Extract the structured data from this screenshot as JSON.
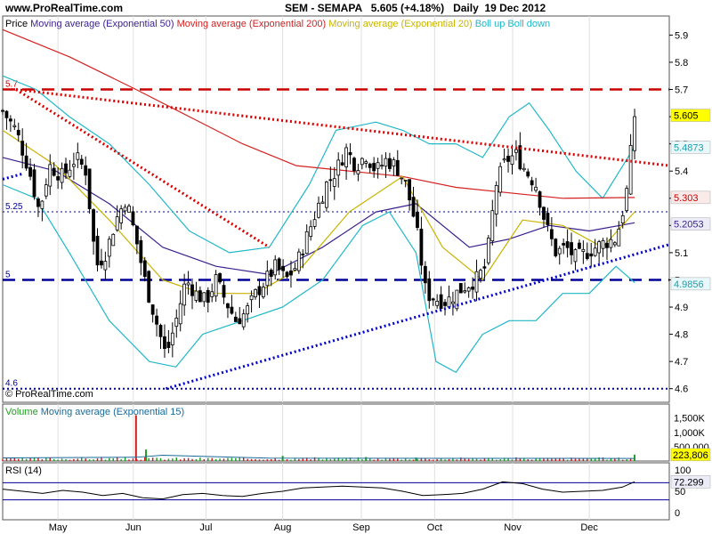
{
  "header": {
    "site": "www.ProRealTime.com",
    "title_symbol": "SEM - SEMAPA",
    "title_price": "5.605 (+4.18%)",
    "title_period": "Daily  19 Dec 2012"
  },
  "copyright": "© ProRealTime.com",
  "legend_price": [
    {
      "text": "Price",
      "color": "#000000"
    },
    {
      "text": "Moving average (Exponential 50)",
      "color": "#3a1f8c"
    },
    {
      "text": "Moving average (Exponential 200)",
      "color": "#d42020"
    },
    {
      "text": "Moving average (Exponential 20)",
      "color": "#c8b400"
    },
    {
      "text": "Boll up Boll down",
      "color": "#20b8c8"
    }
  ],
  "legend_volume": [
    {
      "text": "Volume",
      "color": "#20a020"
    },
    {
      "text": "Moving average (Exponential 15)",
      "color": "#1a6a9a"
    }
  ],
  "legend_rsi": [
    {
      "text": "RSI (14)",
      "color": "#000000"
    }
  ],
  "chart_data": {
    "type": "candlestick",
    "x_labels": [
      "May",
      "Jun",
      "Jul",
      "Aug",
      "Sep",
      "Oct",
      "Nov",
      "Dec"
    ],
    "price_axis": {
      "ylim": [
        4.55,
        5.97
      ],
      "ticks": [
        "5.9",
        "5.8",
        "5.7",
        "5.6",
        "5.5",
        "5.4",
        "5.3",
        "5.2",
        "5.1",
        "5",
        "4.9",
        "4.8",
        "4.7",
        "4.6"
      ]
    },
    "level_labels": [
      {
        "text": "5.7",
        "value": 5.7,
        "color": "#cc0000"
      },
      {
        "text": "5.25",
        "value": 5.25,
        "color": "#000099"
      },
      {
        "text": "5",
        "value": 5.0,
        "color": "#000099"
      },
      {
        "text": "4.6",
        "value": 4.6,
        "color": "#000099"
      }
    ],
    "price_badges": [
      {
        "text": "5.605",
        "value": 5.605,
        "bg": "#ffff00",
        "fg": "#000000"
      },
      {
        "text": "5.4873",
        "value": 5.4873,
        "bg": "#e8f8fb",
        "fg": "#1aa0b0"
      },
      {
        "text": "5.303",
        "value": 5.303,
        "bg": "#fbeaea",
        "fg": "#cc0000"
      },
      {
        "text": "5.2053",
        "value": 5.2053,
        "bg": "#ececf8",
        "fg": "#3a1f8c"
      },
      {
        "text": "4.9856",
        "value": 4.9856,
        "bg": "#e8f8fb",
        "fg": "#1aa0b0"
      }
    ],
    "horizontal_lines": [
      {
        "value": 5.7,
        "color": "#cc0000",
        "style": "dashed"
      },
      {
        "value": 5.0,
        "color": "#000099",
        "style": "dashed"
      },
      {
        "value": 4.6,
        "color": "#000099",
        "style": "dotted"
      },
      {
        "value": 5.25,
        "color": "#000099",
        "style": "thin-dotted"
      }
    ],
    "trendlines": [
      {
        "color": "#dd0000",
        "from": [
          0.02,
          5.7
        ],
        "to": [
          0.4,
          5.12
        ]
      },
      {
        "color": "#dd0000",
        "from": [
          0.02,
          5.7
        ],
        "to": [
          1.0,
          5.42
        ]
      },
      {
        "color": "#0000cc",
        "from": [
          0.245,
          4.6
        ],
        "to": [
          1.0,
          5.13
        ]
      },
      {
        "color": "#0000cc",
        "from": [
          0.0,
          5.37
        ],
        "to": [
          0.03,
          5.39
        ]
      }
    ],
    "close_path": [
      [
        0.0,
        5.62
      ],
      [
        0.02,
        5.55
      ],
      [
        0.04,
        5.4
      ],
      [
        0.055,
        5.25
      ],
      [
        0.07,
        5.42
      ],
      [
        0.09,
        5.38
      ],
      [
        0.11,
        5.45
      ],
      [
        0.125,
        5.4
      ],
      [
        0.14,
        5.05
      ],
      [
        0.155,
        5.1
      ],
      [
        0.17,
        5.22
      ],
      [
        0.185,
        5.3
      ],
      [
        0.2,
        5.15
      ],
      [
        0.215,
        4.98
      ],
      [
        0.23,
        4.85
      ],
      [
        0.245,
        4.72
      ],
      [
        0.26,
        4.85
      ],
      [
        0.275,
        5.0
      ],
      [
        0.29,
        4.95
      ],
      [
        0.305,
        4.92
      ],
      [
        0.32,
        5.0
      ],
      [
        0.335,
        4.92
      ],
      [
        0.35,
        4.85
      ],
      [
        0.365,
        4.88
      ],
      [
        0.38,
        4.95
      ],
      [
        0.395,
        5.0
      ],
      [
        0.41,
        5.05
      ],
      [
        0.425,
        5.0
      ],
      [
        0.44,
        5.05
      ],
      [
        0.455,
        5.15
      ],
      [
        0.47,
        5.25
      ],
      [
        0.485,
        5.35
      ],
      [
        0.5,
        5.4
      ],
      [
        0.515,
        5.48
      ],
      [
        0.53,
        5.42
      ],
      [
        0.545,
        5.46
      ],
      [
        0.56,
        5.4
      ],
      [
        0.575,
        5.44
      ],
      [
        0.59,
        5.42
      ],
      [
        0.605,
        5.35
      ],
      [
        0.62,
        5.2
      ],
      [
        0.635,
        4.95
      ],
      [
        0.65,
        4.93
      ],
      [
        0.665,
        4.92
      ],
      [
        0.68,
        4.95
      ],
      [
        0.695,
        4.98
      ],
      [
        0.71,
        5.0
      ],
      [
        0.725,
        5.05
      ],
      [
        0.74,
        5.35
      ],
      [
        0.755,
        5.44
      ],
      [
        0.77,
        5.46
      ],
      [
        0.785,
        5.4
      ],
      [
        0.8,
        5.35
      ],
      [
        0.815,
        5.2
      ],
      [
        0.83,
        5.1
      ],
      [
        0.845,
        5.12
      ],
      [
        0.86,
        5.08
      ],
      [
        0.875,
        5.1
      ],
      [
        0.89,
        5.12
      ],
      [
        0.905,
        5.14
      ],
      [
        0.92,
        5.15
      ],
      [
        0.935,
        5.3
      ],
      [
        0.948,
        5.605
      ]
    ],
    "ema20": [
      [
        0.0,
        5.55
      ],
      [
        0.08,
        5.42
      ],
      [
        0.16,
        5.22
      ],
      [
        0.24,
        5.0
      ],
      [
        0.3,
        4.95
      ],
      [
        0.38,
        4.95
      ],
      [
        0.45,
        5.05
      ],
      [
        0.52,
        5.25
      ],
      [
        0.6,
        5.38
      ],
      [
        0.66,
        5.12
      ],
      [
        0.72,
        5.0
      ],
      [
        0.78,
        5.22
      ],
      [
        0.84,
        5.2
      ],
      [
        0.9,
        5.12
      ],
      [
        0.948,
        5.25
      ]
    ],
    "ema50": [
      [
        0.0,
        5.45
      ],
      [
        0.08,
        5.4
      ],
      [
        0.16,
        5.28
      ],
      [
        0.24,
        5.12
      ],
      [
        0.32,
        5.05
      ],
      [
        0.4,
        5.02
      ],
      [
        0.48,
        5.12
      ],
      [
        0.56,
        5.25
      ],
      [
        0.62,
        5.28
      ],
      [
        0.7,
        5.12
      ],
      [
        0.76,
        5.15
      ],
      [
        0.82,
        5.2
      ],
      [
        0.88,
        5.18
      ],
      [
        0.948,
        5.21
      ]
    ],
    "ema200": [
      [
        0.0,
        5.92
      ],
      [
        0.1,
        5.82
      ],
      [
        0.2,
        5.7
      ],
      [
        0.28,
        5.6
      ],
      [
        0.36,
        5.5
      ],
      [
        0.44,
        5.42
      ],
      [
        0.52,
        5.4
      ],
      [
        0.6,
        5.38
      ],
      [
        0.68,
        5.34
      ],
      [
        0.76,
        5.32
      ],
      [
        0.84,
        5.3
      ],
      [
        0.948,
        5.303
      ]
    ],
    "boll_up": [
      [
        0.0,
        5.75
      ],
      [
        0.05,
        5.7
      ],
      [
        0.1,
        5.6
      ],
      [
        0.16,
        5.5
      ],
      [
        0.22,
        5.35
      ],
      [
        0.28,
        5.18
      ],
      [
        0.34,
        5.1
      ],
      [
        0.4,
        5.12
      ],
      [
        0.46,
        5.35
      ],
      [
        0.5,
        5.55
      ],
      [
        0.56,
        5.58
      ],
      [
        0.6,
        5.55
      ],
      [
        0.64,
        5.5
      ],
      [
        0.68,
        5.5
      ],
      [
        0.72,
        5.45
      ],
      [
        0.76,
        5.6
      ],
      [
        0.79,
        5.65
      ],
      [
        0.82,
        5.55
      ],
      [
        0.86,
        5.4
      ],
      [
        0.9,
        5.3
      ],
      [
        0.948,
        5.49
      ]
    ],
    "boll_down": [
      [
        0.0,
        5.35
      ],
      [
        0.05,
        5.3
      ],
      [
        0.1,
        5.1
      ],
      [
        0.16,
        4.85
      ],
      [
        0.22,
        4.7
      ],
      [
        0.26,
        4.68
      ],
      [
        0.3,
        4.8
      ],
      [
        0.36,
        4.85
      ],
      [
        0.42,
        4.9
      ],
      [
        0.48,
        5.0
      ],
      [
        0.54,
        5.2
      ],
      [
        0.58,
        5.25
      ],
      [
        0.62,
        5.1
      ],
      [
        0.65,
        4.7
      ],
      [
        0.68,
        4.66
      ],
      [
        0.72,
        4.8
      ],
      [
        0.76,
        4.85
      ],
      [
        0.8,
        4.85
      ],
      [
        0.84,
        4.95
      ],
      [
        0.88,
        4.95
      ],
      [
        0.92,
        5.05
      ],
      [
        0.948,
        4.99
      ]
    ],
    "volume_axis": {
      "ticks": [
        "1,500K",
        "1,000K",
        "500,000"
      ],
      "ylim": [
        0,
        1800000
      ]
    },
    "volume_badge": "223,806",
    "volume_spikes": [
      [
        0.2,
        1600000
      ],
      [
        0.215,
        400000
      ],
      [
        0.42,
        180000
      ],
      [
        0.545,
        140000
      ],
      [
        0.62,
        120000
      ],
      [
        0.948,
        223806
      ]
    ],
    "rsi_axis": {
      "ticks": [
        "100",
        "50",
        "0"
      ],
      "ylim": [
        0,
        100
      ],
      "bands": [
        30,
        70
      ]
    },
    "rsi_badge": "72.299",
    "rsi": [
      [
        0.0,
        55
      ],
      [
        0.03,
        50
      ],
      [
        0.06,
        45
      ],
      [
        0.09,
        52
      ],
      [
        0.12,
        48
      ],
      [
        0.15,
        40
      ],
      [
        0.18,
        45
      ],
      [
        0.21,
        35
      ],
      [
        0.24,
        32
      ],
      [
        0.27,
        42
      ],
      [
        0.3,
        45
      ],
      [
        0.33,
        40
      ],
      [
        0.36,
        38
      ],
      [
        0.39,
        45
      ],
      [
        0.42,
        50
      ],
      [
        0.45,
        58
      ],
      [
        0.48,
        60
      ],
      [
        0.51,
        62
      ],
      [
        0.54,
        60
      ],
      [
        0.57,
        58
      ],
      [
        0.6,
        50
      ],
      [
        0.63,
        40
      ],
      [
        0.66,
        42
      ],
      [
        0.69,
        45
      ],
      [
        0.72,
        55
      ],
      [
        0.75,
        72
      ],
      [
        0.78,
        68
      ],
      [
        0.81,
        55
      ],
      [
        0.84,
        48
      ],
      [
        0.87,
        50
      ],
      [
        0.9,
        52
      ],
      [
        0.93,
        60
      ],
      [
        0.948,
        72.3
      ]
    ]
  }
}
